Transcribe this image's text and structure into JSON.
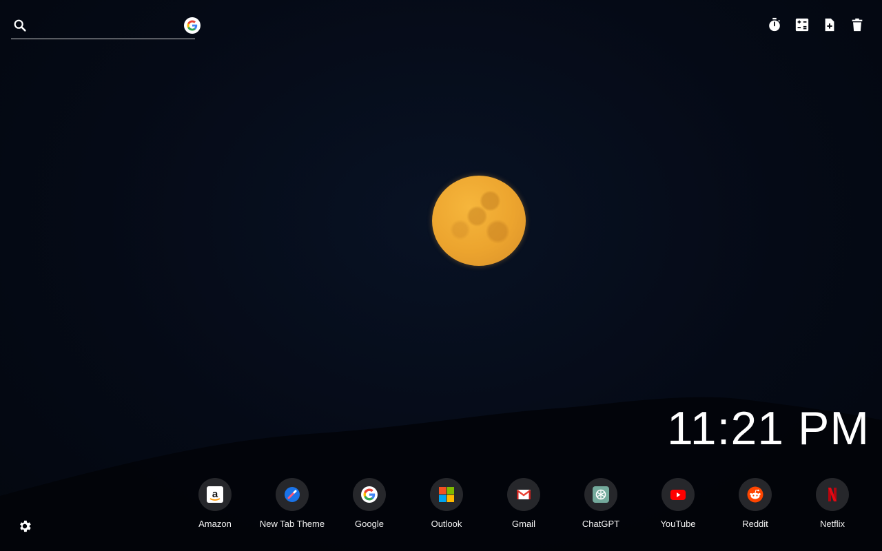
{
  "search": {
    "value": "",
    "placeholder": "",
    "search_icon": "search-icon",
    "engine_icon": "google-icon"
  },
  "tools": [
    {
      "name": "timer",
      "icon": "stopwatch-icon"
    },
    {
      "name": "calculator",
      "icon": "calculator-icon"
    },
    {
      "name": "new-note",
      "icon": "file-add-icon"
    },
    {
      "name": "delete",
      "icon": "trash-icon"
    }
  ],
  "clock": {
    "time": "11:21 PM"
  },
  "shortcuts": [
    {
      "label": "Amazon",
      "icon": "amazon-icon"
    },
    {
      "label": "New Tab Theme",
      "icon": "new-tab-theme-icon"
    },
    {
      "label": "Google",
      "icon": "google-icon"
    },
    {
      "label": "Outlook",
      "icon": "outlook-icon"
    },
    {
      "label": "Gmail",
      "icon": "gmail-icon"
    },
    {
      "label": "ChatGPT",
      "icon": "chatgpt-icon"
    },
    {
      "label": "YouTube",
      "icon": "youtube-icon"
    },
    {
      "label": "Reddit",
      "icon": "reddit-icon"
    },
    {
      "label": "Netflix",
      "icon": "netflix-icon"
    }
  ],
  "settings": {
    "icon": "gear-icon"
  },
  "colors": {
    "background": "#040812",
    "moon": "#eca42e",
    "shortcut_bg": "#26272b",
    "text": "#ffffff"
  }
}
